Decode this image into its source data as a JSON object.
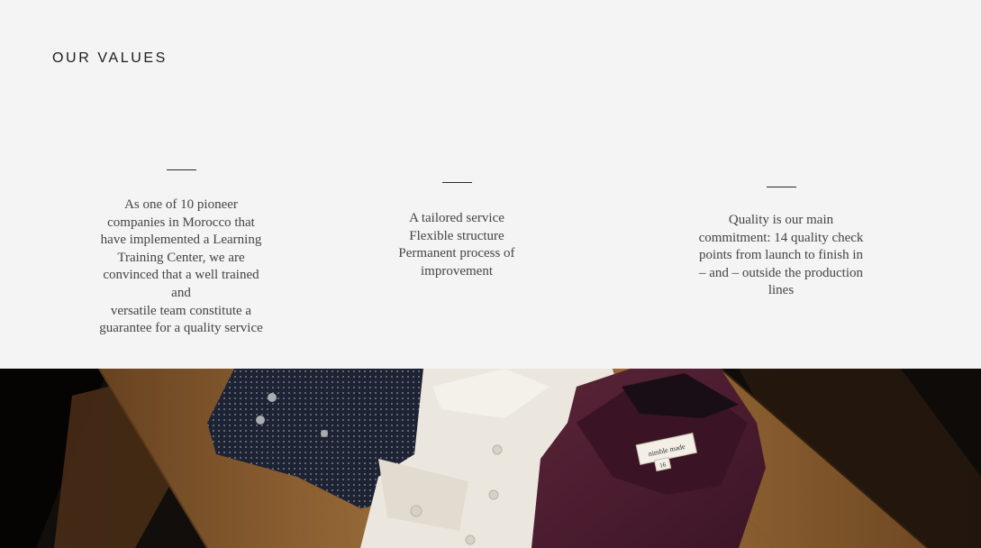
{
  "values": {
    "title": "OUR VALUES",
    "items": [
      {
        "text": "As one of 10 pioneer\ncompanies in Morocco that\nhave implemented  a Learning\nTraining Center, we are\nconvinced  that a well trained\nand\nversatile team constitute a\nguarantee for a quality service"
      },
      {
        "text": "A tailored service\nFlexible structure\nPermanent process of\nimprovement"
      },
      {
        "text": "Quality is our main\ncommitment: 14 quality check\npoints from launch to finish in\n– and – outside the production\nlines"
      }
    ]
  },
  "hero": {
    "label_line1": "nimble made",
    "label_line2": "16",
    "colors": {
      "wood": "#b07a40",
      "navy_shirt": "#1c2232",
      "white_shirt": "#ebe6dc",
      "burgundy_shirt": "#4e1f33"
    }
  }
}
